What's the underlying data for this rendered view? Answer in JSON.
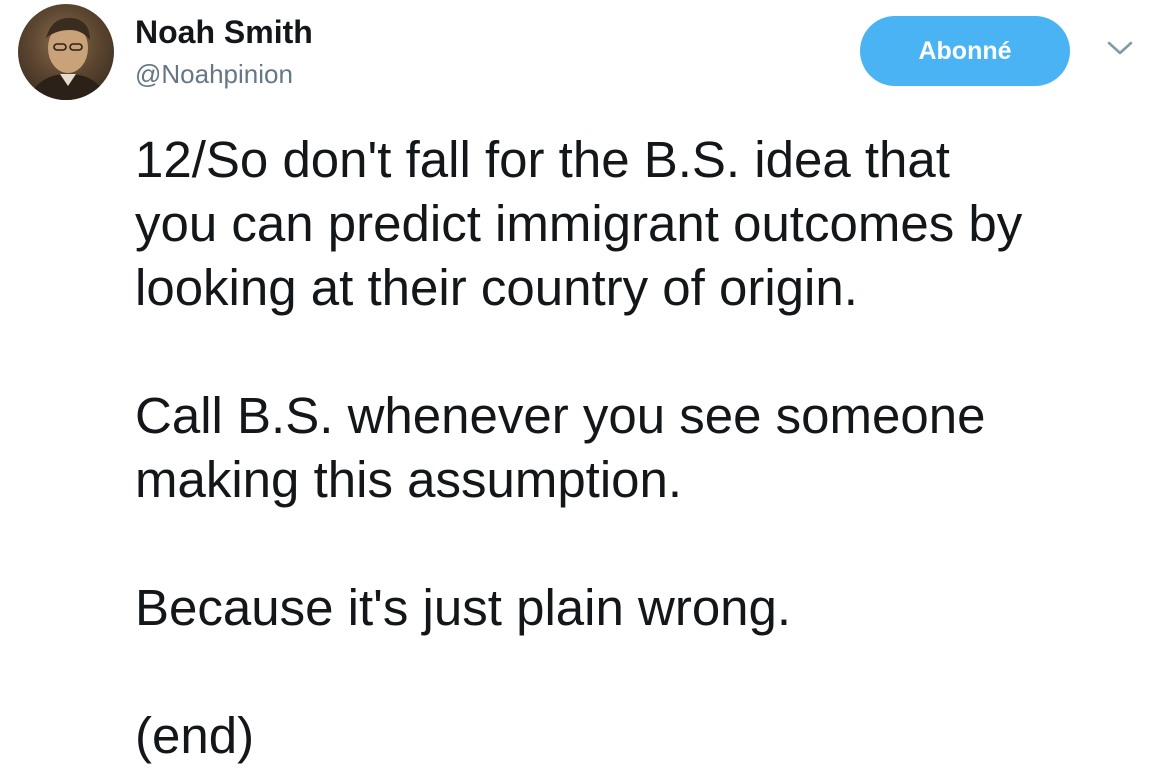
{
  "author": {
    "display_name": "Noah Smith",
    "handle": "@Noahpinion",
    "avatar_icon": "user-avatar-photo"
  },
  "follow_button": {
    "label": "Abonné",
    "color": "#4ab3f4"
  },
  "menu_icon": "chevron-down-icon",
  "tweet": {
    "paragraphs": [
      {
        "lines": [
          "12/So don't fall for the B.S. idea that",
          "you can predict immigrant outcomes by",
          "looking at their country of origin."
        ]
      },
      {
        "lines": [
          "Call B.S. whenever you see someone",
          "making this assumption."
        ]
      },
      {
        "lines": [
          "Because it's just plain wrong."
        ]
      },
      {
        "lines": [
          "(end)"
        ]
      }
    ]
  }
}
